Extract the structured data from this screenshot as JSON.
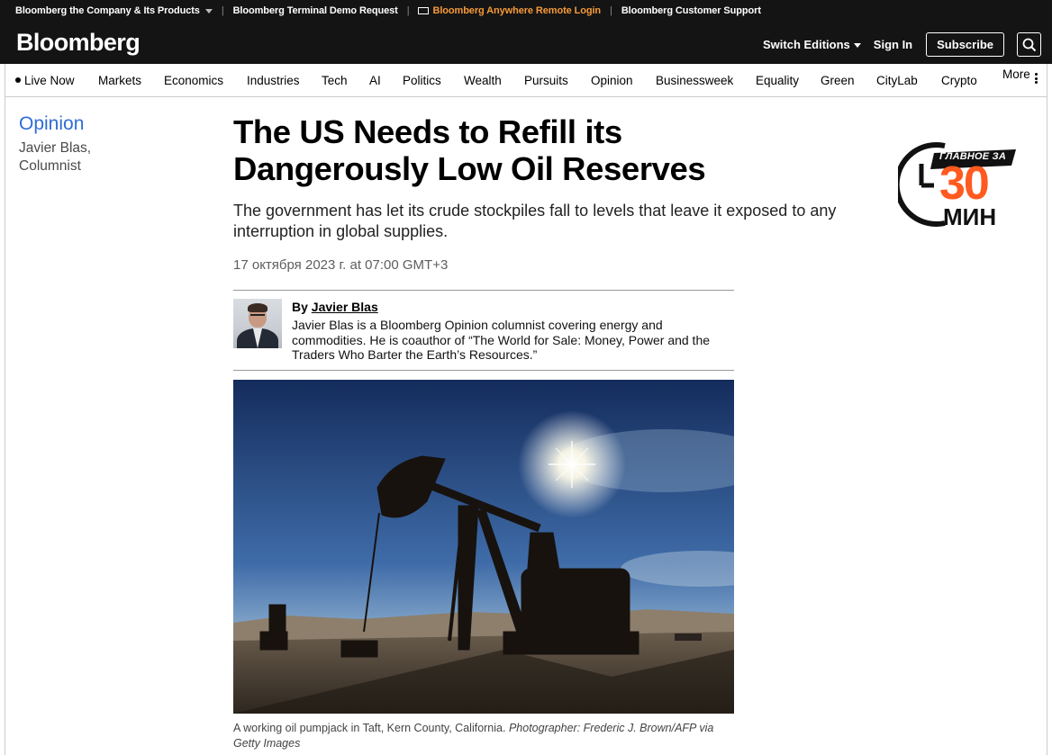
{
  "utility_bar": {
    "items": [
      "Bloomberg the Company & Its Products",
      "Bloomberg Terminal Demo Request",
      "Bloomberg Anywhere Remote Login",
      "Bloomberg Customer Support"
    ],
    "highlight_color": "#f79a3a"
  },
  "header": {
    "logo": "Bloomberg",
    "switch_editions": "Switch Editions",
    "sign_in": "Sign In",
    "subscribe": "Subscribe",
    "search_icon": "search-icon"
  },
  "nav": {
    "items": [
      "Live Now",
      "Markets",
      "Economics",
      "Industries",
      "Tech",
      "AI",
      "Politics",
      "Wealth",
      "Pursuits",
      "Opinion",
      "Businessweek",
      "Equality",
      "Green",
      "CityLab",
      "Crypto",
      "More"
    ]
  },
  "sidebar": {
    "section": "Opinion",
    "author_name": "Javier Blas,",
    "author_role": "Columnist"
  },
  "article": {
    "headline_line1": "The US Needs to Refill its",
    "headline_line2": "Dangerously Low Oil Reserves",
    "dek": "The government has let its crude stockpiles fall to levels that leave it exposed to any interruption in global supplies.",
    "date": "17 октября 2023 г. at 07:00 GMT+3",
    "byline_prefix": "By",
    "byline_author": "Javier Blas",
    "bio": "Javier Blas is a Bloomberg Opinion columnist covering energy and commodities. He is coauthor of “The World for Sale: Money, Power and the Traders Who Barter the Earth’s Resources.”",
    "caption_text": "A working oil pumpjack in Taft, Kern County, California.",
    "caption_credit": "Photographer: Frederic J. Brown/AFP via Getty Images"
  },
  "badge": {
    "top_text": "ГЛАВНОЕ ЗА",
    "number": "30",
    "unit": "МИН",
    "accent": "#ff5a1f"
  },
  "colors": {
    "topbar": "#141414",
    "section_link": "#2f6bd6"
  }
}
